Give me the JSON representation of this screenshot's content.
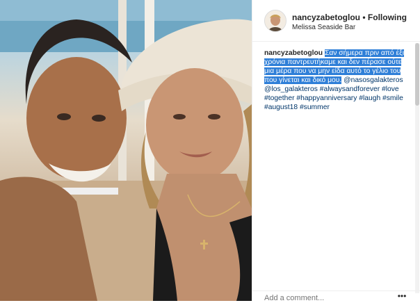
{
  "post": {
    "username": "nancyzabetoglou",
    "separator": "•",
    "follow_state": "Following",
    "location": "Melissa Seaside Bar"
  },
  "caption": {
    "username": "nancyzabetoglou",
    "selected_text": "Σαν σήμερα πριν από έξι χρόνια παντρευτήκαμε και δεν πέρασε ούτε μια μέρα που να μην είδα αυτό το γέλιο του που γίνεται και δικό μου.",
    "mention1": "@nasosgalakteros",
    "mention2": "@los_galakteros",
    "hashtags_line1": "#alwaysandforever",
    "hashtags_line2": "#love #together #happyanniversary",
    "hashtags_line3": "#laugh #smile #august18 #summer"
  },
  "comment": {
    "placeholder": "Add a comment..."
  },
  "icons": {
    "more": "more-options-icon"
  }
}
